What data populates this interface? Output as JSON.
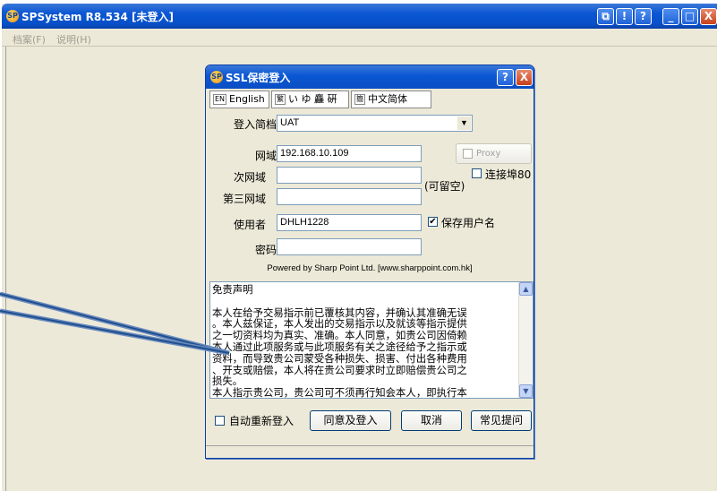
{
  "main_window": {
    "title": "SPSystem R8.534 [未登入]",
    "titlebar_buttons": [
      "⧉",
      "!",
      "?",
      "_",
      "□",
      "X"
    ],
    "menu": [
      "档案(F)",
      "说明(H)"
    ]
  },
  "dialog": {
    "title": "SSL保密登入",
    "help_label": "?",
    "close_label": "X",
    "languages": [
      {
        "flag": "EN",
        "label": "English"
      },
      {
        "flag": "繁",
        "label": "い ゆ 麤 硏"
      },
      {
        "flag": "簡",
        "label": "中文简体"
      }
    ],
    "profile": {
      "label": "登入简档",
      "value": "UAT",
      "arrow": "▼"
    },
    "host": {
      "label": "网域",
      "value": "192.168.10.109"
    },
    "host2": {
      "label": "次网域",
      "value": ""
    },
    "host3": {
      "label": "第三网域",
      "value": ""
    },
    "optional_note": "(可留空)",
    "proxy_label": "Proxy",
    "port80_label": "连接埠80",
    "user": {
      "label": "使用者",
      "value": "DHLH1228"
    },
    "save_user_label": "保存用户名",
    "password": {
      "label": "密码",
      "value": ""
    },
    "powered_by": "Powered by Sharp Point Ltd. [www.sharppoint.com.hk]",
    "disclaimer": {
      "lines": [
        "免责声明",
        "",
        "本人在给予交易指示前已覆核其内容，并确认其准确无误",
        "。本人兹保证，本人发出的交易指示以及就该等指示提供",
        "之一切资料均为真实、准确。本人同意，如贵公司因倚赖",
        "本人通过此项服务或与此项服务有关之途径给予之指示或",
        "资料，而导致贵公司蒙受各种损失、损害、付出各种费用",
        "、开支或赔偿，本人将在贵公司要求时立即赔偿贵公司之",
        "损失。",
        "本人指示贵公司，贵公司可不须再行知会本人，即执行本"
      ]
    },
    "auto_relogin_label": "自动重新登入",
    "agree_login_button": "同意及登入",
    "cancel_button": "取消",
    "faq_button": "常见提问",
    "checks": {
      "proxy": "",
      "port80": "",
      "save_user": "✔",
      "auto_relogin": ""
    }
  }
}
